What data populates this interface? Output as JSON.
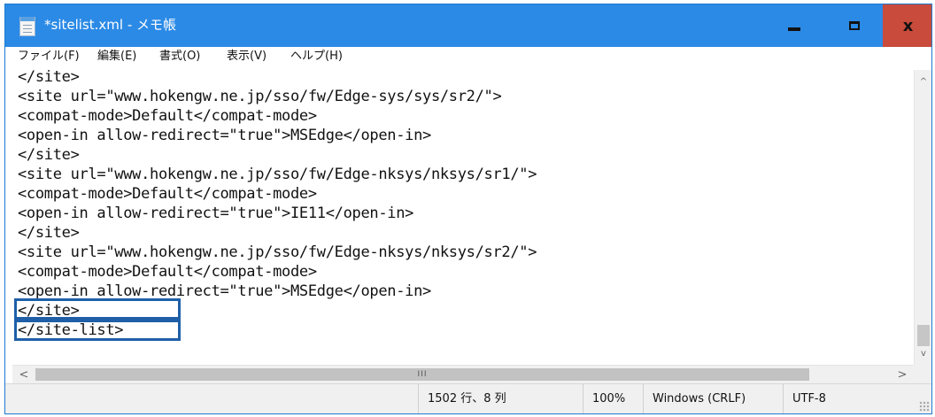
{
  "window": {
    "title": "*sitelist.xml - メモ帳",
    "close_glyph": "x"
  },
  "menu": {
    "items": [
      "ファイル(F)",
      "編集(E)",
      "書式(O)",
      "表示(V)",
      "ヘルプ(H)"
    ]
  },
  "editor": {
    "lines": [
      "</site>",
      "<site url=\"www.hokengw.ne.jp/sso/fw/Edge-sys/sys/sr2/\">",
      "<compat-mode>Default</compat-mode>",
      "<open-in allow-redirect=\"true\">MSEdge</open-in>",
      "</site>",
      "<site url=\"www.hokengw.ne.jp/sso/fw/Edge-nksys/nksys/sr1/\">",
      "<compat-mode>Default</compat-mode>",
      "<open-in allow-redirect=\"true\">IE11</open-in>",
      "</site>",
      "<site url=\"www.hokengw.ne.jp/sso/fw/Edge-nksys/nksys/sr2/\">",
      "<compat-mode>Default</compat-mode>",
      "<open-in allow-redirect=\"true\">MSEdge</open-in>",
      "</site>",
      "</site-list>"
    ],
    "highlight_color": "#1f5fa8"
  },
  "scrollbars": {
    "up": "^",
    "down": "v",
    "left": "<",
    "right": ">",
    "h_thumb_grip": "III"
  },
  "status": {
    "position": "1502 行、8 列",
    "zoom": "100%",
    "line_ending": "Windows (CRLF)",
    "encoding": "UTF-8"
  },
  "colors": {
    "titlebar": "#2b8ae6",
    "close_button": "#c84b3c"
  }
}
